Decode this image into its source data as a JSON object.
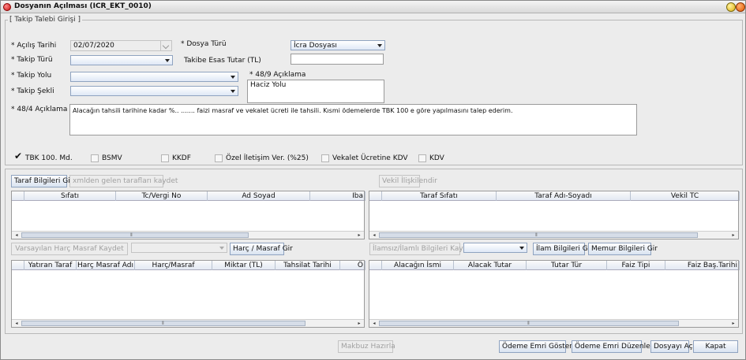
{
  "window": {
    "title": "Dosyanın Açılması (ICR_EKT_0010)"
  },
  "section": {
    "legend": "[ Takip Talebi Girişi ]"
  },
  "form": {
    "acilis_tarihi_label": "* Açılış Tarihi",
    "acilis_tarihi_value": "02/07/2020",
    "dosya_turu_label": "* Dosya Türü",
    "dosya_turu_value": "İcra Dosyası",
    "takip_turu_label": "* Takip Türü",
    "takibe_esas_tutar_label": "Takibe Esas Tutar (TL)",
    "takip_yolu_label": "* Takip Yolu",
    "aciklama_489_label": "* 48/9 Açıklama",
    "aciklama_489_value": "Haciz Yolu",
    "takip_sekli_label": "* Takip Şekli",
    "aciklama_484_label": "* 48/4 Açıklama",
    "aciklama_484_value": "Alacağın tahsili tarihine kadar %.. ....... faizi masraf ve vekalet ücreti ile tahsili. Kısmi ödemelerde TBK 100 e göre yapılmasını talep ederim."
  },
  "checkboxes": [
    {
      "label": "TBK 100. Md.",
      "checked": true
    },
    {
      "label": "BSMV",
      "checked": false
    },
    {
      "label": "KKDF",
      "checked": false
    },
    {
      "label": "Özel İletişim Ver. (%25)",
      "checked": false
    },
    {
      "label": "Vekalet Ücretine KDV",
      "checked": false
    },
    {
      "label": "KDV",
      "checked": false
    }
  ],
  "taraf": {
    "taraf_bilgileri_btn": "Taraf Bilgileri Gir",
    "xmlden_btn": "xmlden gelen tarafları kaydet",
    "columns": [
      "Sıfatı",
      "Tc/Vergi No",
      "Ad Soyad",
      "Iba"
    ]
  },
  "vekil": {
    "vekil_btn": "Vekil İlişkilendir",
    "columns": [
      "Taraf Sıfatı",
      "Taraf Adı-Soyadı",
      "Vekil TC"
    ]
  },
  "harc": {
    "varsayilan_btn": "Varsayılan Harç Masraf Kaydet",
    "harc_masraf_btn": "Harç / Masraf Gir",
    "columns": [
      "Yatıran Taraf",
      "Harç Masraf Adı",
      "Harç/Masraf",
      "Miktar (TL)",
      "Tahsilat Tarihi",
      "Ö"
    ]
  },
  "ilam": {
    "ilamsiz_btn": "İlamsız/İlamlı Bilgileri Kaydet",
    "ilam_btn": "İlam Bilgileri Gir",
    "memur_btn": "Memur Bilgileri Gir",
    "columns": [
      "Alacağın İsmi",
      "Alacak Tutar",
      "Tutar Tür",
      "Faiz Tipi",
      "Faiz Baş.Tarihi"
    ]
  },
  "footer": {
    "makbuz_btn": "Makbuz Hazırla",
    "odeme_goster_btn": "Ödeme Emri Göster",
    "odeme_duzenle_btn": "Ödeme Emri Düzenle",
    "dosyayi_ac_btn": "Dosyayı Aç",
    "kapat_btn": "Kapat"
  },
  "colors": {
    "accent": "#8fa3c0",
    "close": "#e35a00",
    "minimize": "#f0c419"
  }
}
